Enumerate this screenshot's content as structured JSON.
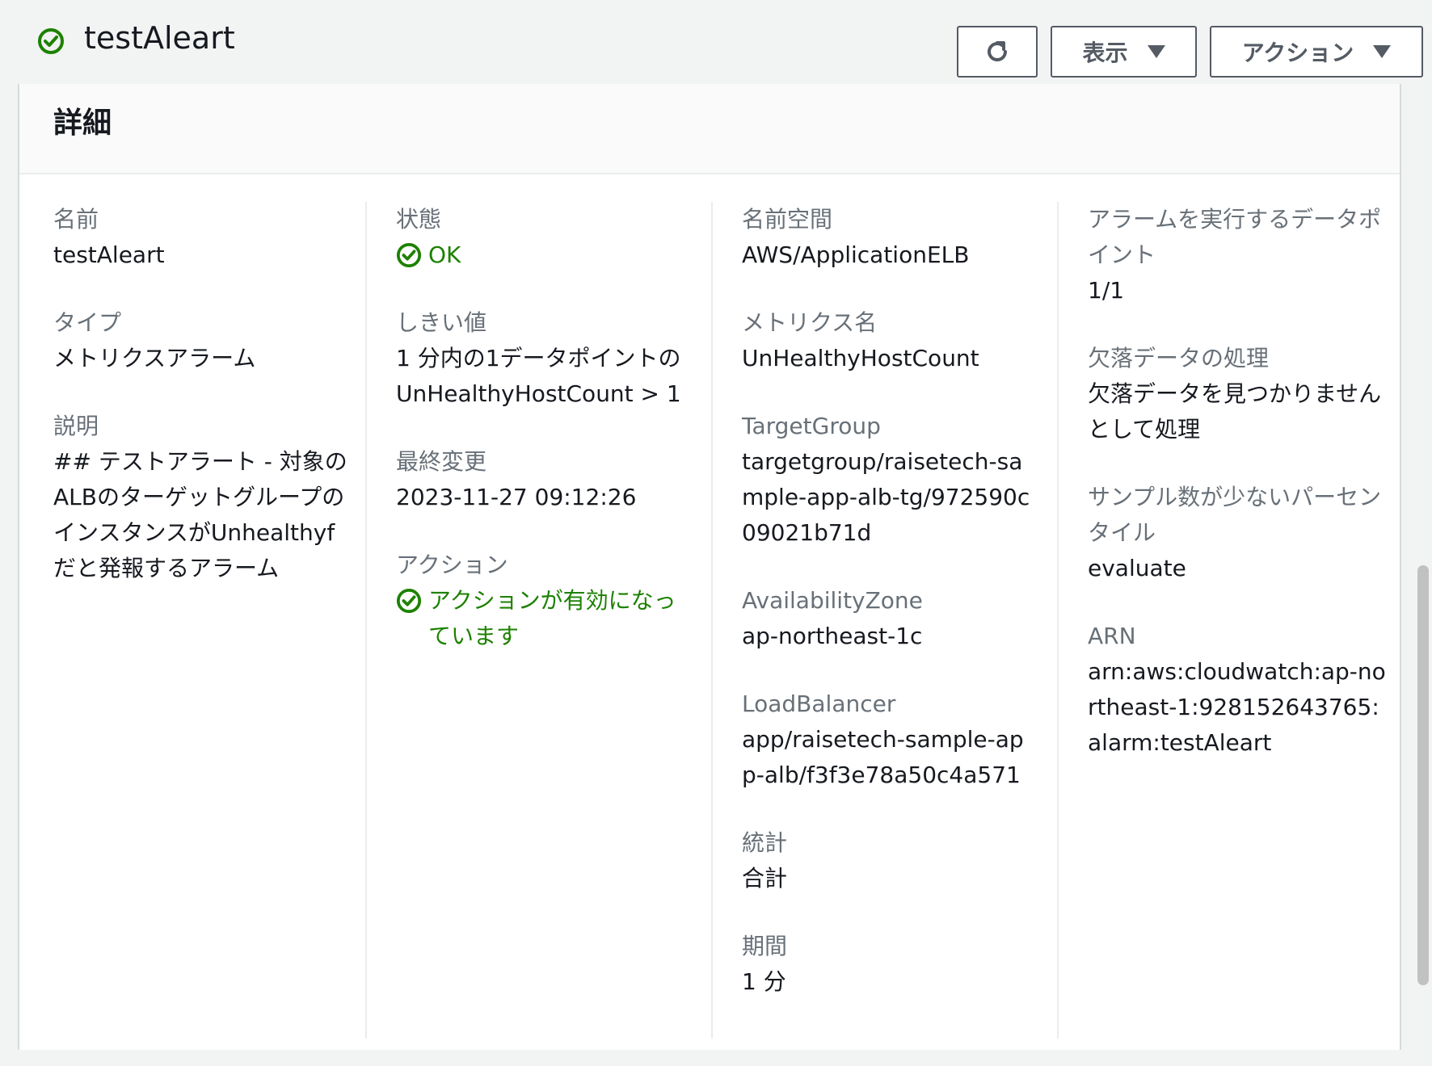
{
  "header": {
    "title": "testAleart",
    "display_label": "表示",
    "actions_label": "アクション"
  },
  "panel": {
    "title": "詳細"
  },
  "columns": {
    "c1": {
      "name_label": "名前",
      "name_value": "testAleart",
      "type_label": "タイプ",
      "type_value": "メトリクスアラーム",
      "desc_label": "説明",
      "desc_value": "## テストアラート - 対象のALBのターゲットグループのインスタンスがUnhealthyfだと発報するアラーム"
    },
    "c2": {
      "state_label": "状態",
      "state_value": "OK",
      "threshold_label": "しきい値",
      "threshold_value": "1 分内の1データポイントのUnHealthyHostCount > 1",
      "modified_label": "最終変更",
      "modified_value": "2023-11-27 09:12:26",
      "action_label": "アクション",
      "action_value": "アクションが有効になっています"
    },
    "c3": {
      "namespace_label": "名前空間",
      "namespace_value": "AWS/ApplicationELB",
      "metric_label": "メトリクス名",
      "metric_value": "UnHealthyHostCount",
      "tg_label": "TargetGroup",
      "tg_value": "targetgroup/raisetech-sample-app-alb-tg/972590c09021b71d",
      "az_label": "AvailabilityZone",
      "az_value": "ap-northeast-1c",
      "lb_label": "LoadBalancer",
      "lb_value": "app/raisetech-sample-app-alb/f3f3e78a50c4a571",
      "stat_label": "統計",
      "stat_value": "合計",
      "period_label": "期間",
      "period_value": "1 分"
    },
    "c4": {
      "dp_label": "アラームを実行するデータポイント",
      "dp_value": "1/1",
      "missing_label": "欠落データの処理",
      "missing_value": "欠落データを見つかりませんとして処理",
      "sample_label": "サンプル数が少ないパーセンタイル",
      "sample_value": "evaluate",
      "arn_label": "ARN",
      "arn_value": "arn:aws:cloudwatch:ap-northeast-1:928152643765:alarm:testAleart"
    }
  },
  "colors": {
    "ok_green": "#1d8102",
    "label_gray": "#687078",
    "border": "#545b64"
  },
  "icons": [
    "check-circle-icon",
    "refresh-icon",
    "caret-down-icon"
  ]
}
